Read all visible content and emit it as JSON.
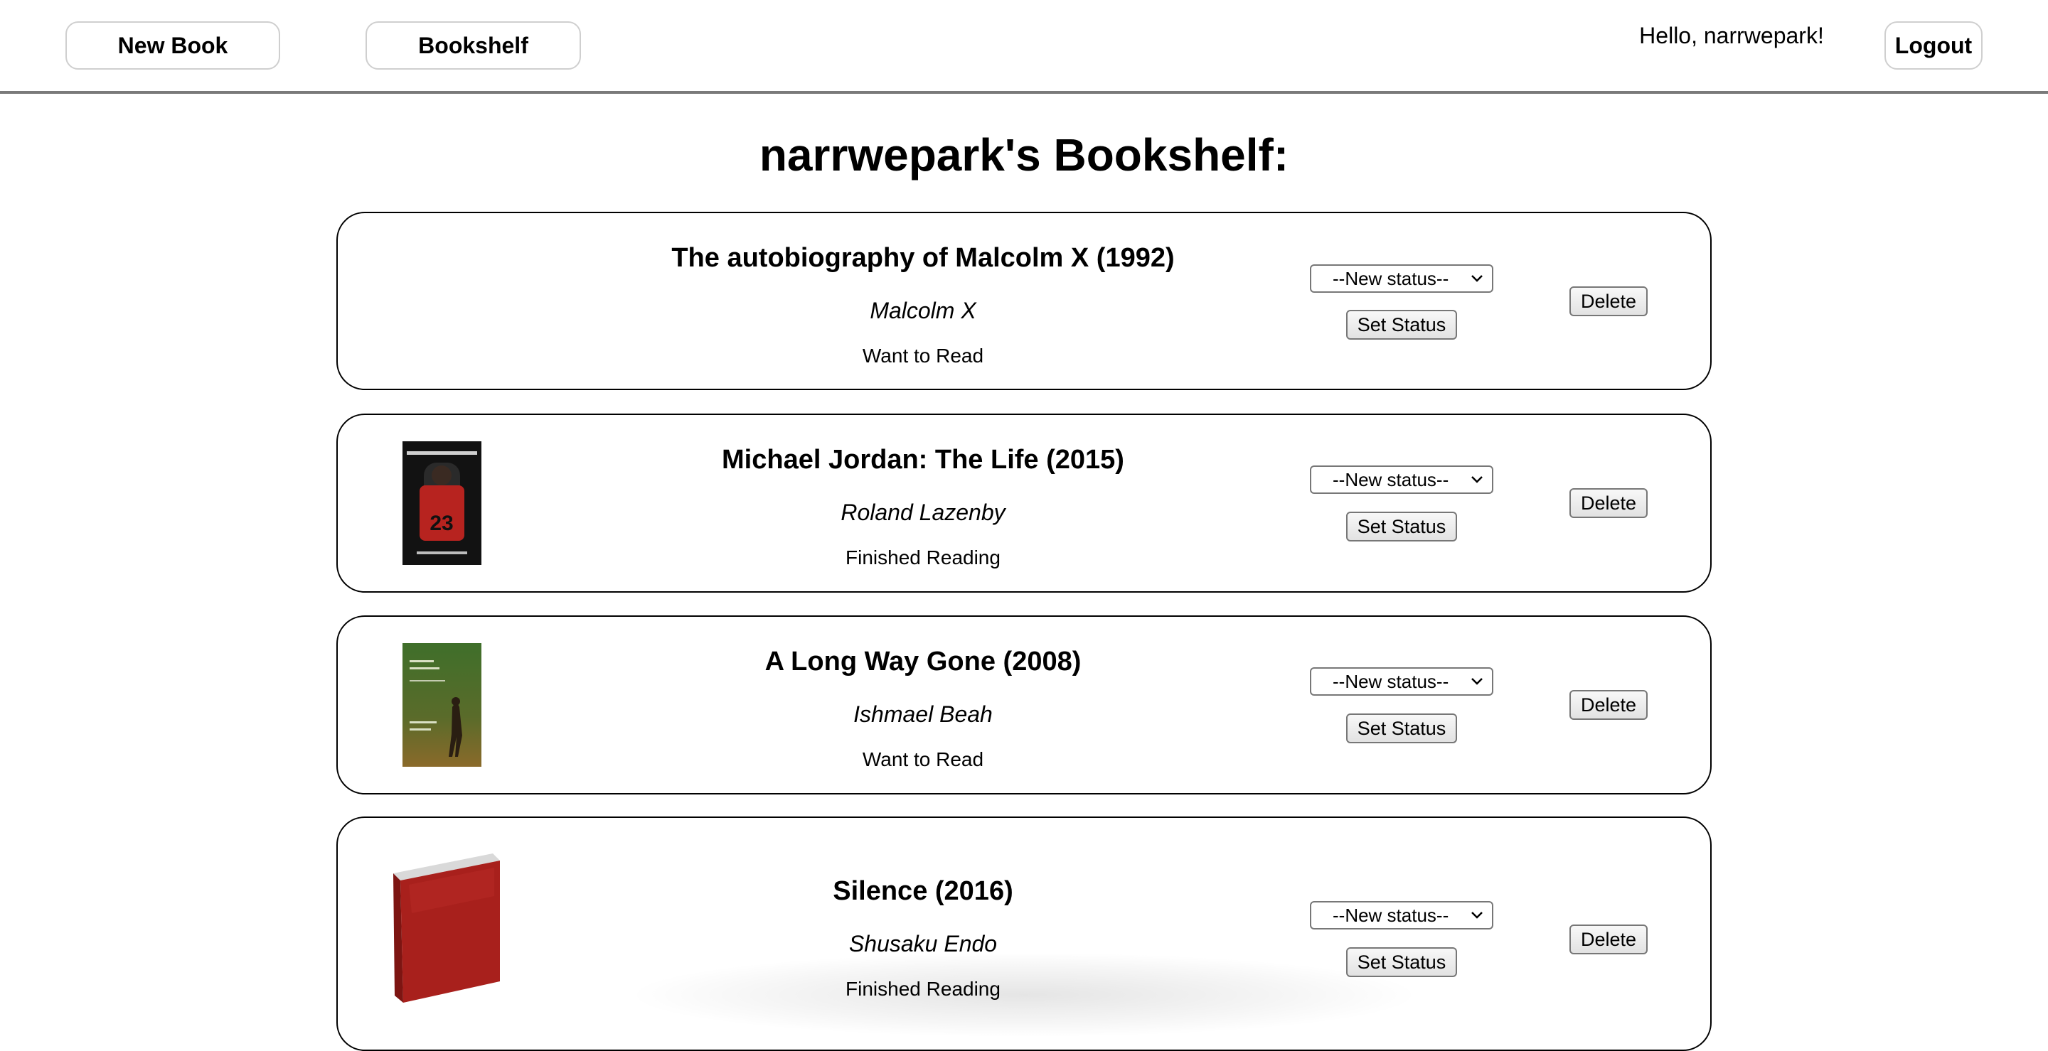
{
  "nav": {
    "new_book_label": "New Book",
    "bookshelf_label": "Bookshelf",
    "greeting": "Hello, narrwepark!",
    "logout_label": "Logout"
  },
  "page_title": "narrwepark's Bookshelf:",
  "status_select_placeholder": "--New status--",
  "set_status_label": "Set Status",
  "delete_label": "Delete",
  "books": [
    {
      "title": "The autobiography of Malcolm X (1992)",
      "author": "Malcolm X",
      "status": "Want to Read",
      "cover": "none"
    },
    {
      "title": "Michael Jordan: The Life (2015)",
      "author": "Roland Lazenby",
      "status": "Finished Reading",
      "cover": "michael-jordan-cover"
    },
    {
      "title": "A Long Way Gone (2008)",
      "author": "Ishmael Beah",
      "status": "Want to Read",
      "cover": "long-way-gone-cover"
    },
    {
      "title": "Silence (2016)",
      "author": "Shusaku Endo",
      "status": "Finished Reading",
      "cover": "generic-red-book"
    }
  ]
}
